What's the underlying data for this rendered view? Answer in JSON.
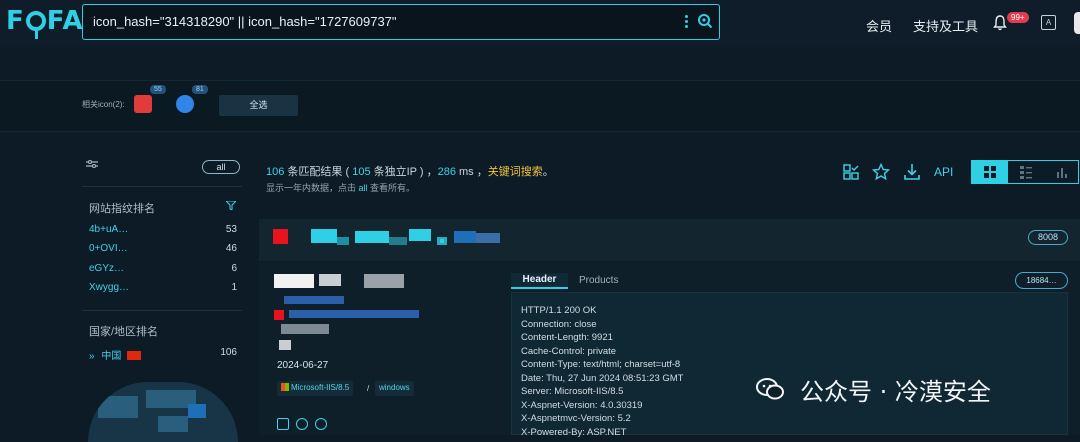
{
  "brand": {
    "logo": "FOFA"
  },
  "search": {
    "query": "icon_hash=\"314318290\" || icon_hash=\"1727609737\""
  },
  "nav": {
    "member": "会员",
    "support": "支持及工具",
    "notification_badge": "99+",
    "lang_icon": "translate-icon"
  },
  "icons": {
    "label": "相关icon(2):",
    "items": [
      {
        "count": "55",
        "color": "#e23b3b"
      },
      {
        "count": "81",
        "color": "#2f86e8"
      }
    ],
    "select_all": "全选"
  },
  "sidebar": {
    "all_label": "all",
    "fingerprint_title": "网站指纹排名",
    "fingerprints": [
      {
        "name": "4b+uA…",
        "count": "53"
      },
      {
        "name": "0+OVI…",
        "count": "46"
      },
      {
        "name": "eGYz…",
        "count": "6"
      },
      {
        "name": "Xwygg…",
        "count": "1"
      }
    ],
    "country_title": "国家/地区排名",
    "country": {
      "name": "中国",
      "count": "106"
    }
  },
  "results": {
    "total": "106",
    "total_suffix": " 条匹配结果 ( ",
    "unique": "105",
    "unique_suffix": " 条独立IP ) ，",
    "ms": "286",
    "ms_suffix": " ms ，",
    "keyword_search": "关键词搜索",
    "end": "。",
    "sub_prefix": "显示一年内数据，点击 ",
    "sub_all": "all",
    "sub_suffix": " 查看所有。",
    "api": "API"
  },
  "card": {
    "port": "8008",
    "date": "2024-06-27",
    "tags": [
      "Microsoft-IIS/8.5",
      "windows"
    ],
    "separator": "/",
    "tabs": {
      "header": "Header",
      "products": "Products"
    },
    "hash": "18684…",
    "header_lines": [
      "HTTP/1.1 200 OK",
      "Connection: close",
      "Content-Length: 9921",
      "Cache-Control: private",
      "Content-Type: text/html; charset=utf-8",
      "Date: Thu, 27 Jun 2024 08:51:23 GMT",
      "Server: Microsoft-IIS/8.5",
      "X-Aspnet-Version: 4.0.30319",
      "X-Aspnetmvc-Version: 5.2",
      "X-Powered-By: ASP.NET"
    ]
  },
  "watermark": "公众号 · 冷漠安全",
  "colors": {
    "accent": "#2fd0e6",
    "keyword": "#f3c33c",
    "badge": "#e33a4d"
  }
}
